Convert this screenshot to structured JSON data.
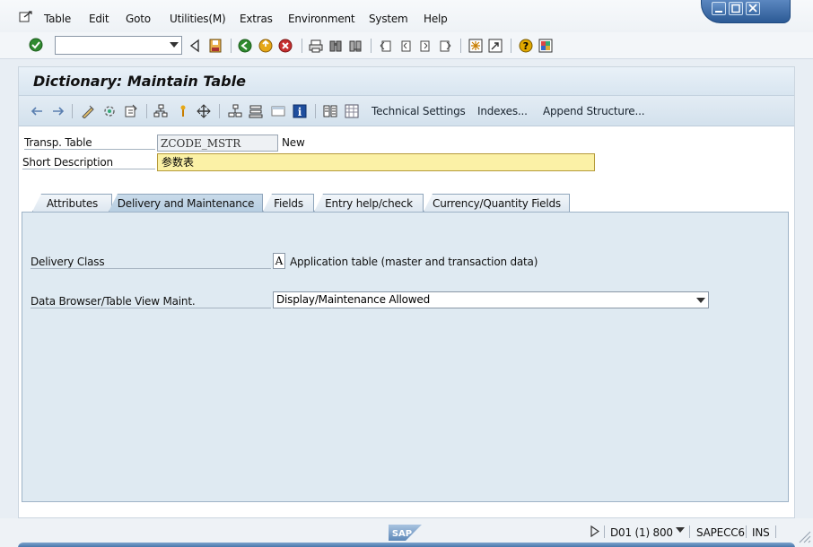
{
  "menu": {
    "items": [
      {
        "label": "Table"
      },
      {
        "label": "Edit"
      },
      {
        "label": "Goto"
      },
      {
        "label": "Utilities(M)"
      },
      {
        "label": "Extras"
      },
      {
        "label": "Environment"
      },
      {
        "label": "System"
      },
      {
        "label": "Help"
      }
    ]
  },
  "screen": {
    "title": "Dictionary: Maintain Table"
  },
  "app_toolbar": {
    "technical_settings": "Technical Settings",
    "indexes": "Indexes...",
    "append_structure": "Append Structure..."
  },
  "header_fields": {
    "transp_table_label": "Transp. Table",
    "transp_table_value": "ZCODE_MSTR",
    "status": "New",
    "short_description_label": "Short Description",
    "short_description_value": "参数表"
  },
  "tabs": [
    {
      "label": "Attributes",
      "active": false
    },
    {
      "label": "Delivery and Maintenance",
      "active": true
    },
    {
      "label": "Fields",
      "active": false
    },
    {
      "label": "Entry help/check",
      "active": false
    },
    {
      "label": "Currency/Quantity Fields",
      "active": false
    }
  ],
  "delivery": {
    "class_label": "Delivery Class",
    "class_value": "A",
    "class_description": "Application table (master and transaction data)",
    "browser_label": "Data Browser/Table View Maint.",
    "browser_value": "Display/Maintenance Allowed"
  },
  "status_bar": {
    "logo": "SAP",
    "system": "D01 (1) 800",
    "server": "SAPECC6",
    "mode": "INS"
  },
  "colors": {
    "title_text": "#111111",
    "required_field_bg": "#fbf1a6",
    "tab_active_bg": "#b7cee2",
    "enter_icon": "#2f8a2f",
    "help_icon": "#e0a800"
  }
}
